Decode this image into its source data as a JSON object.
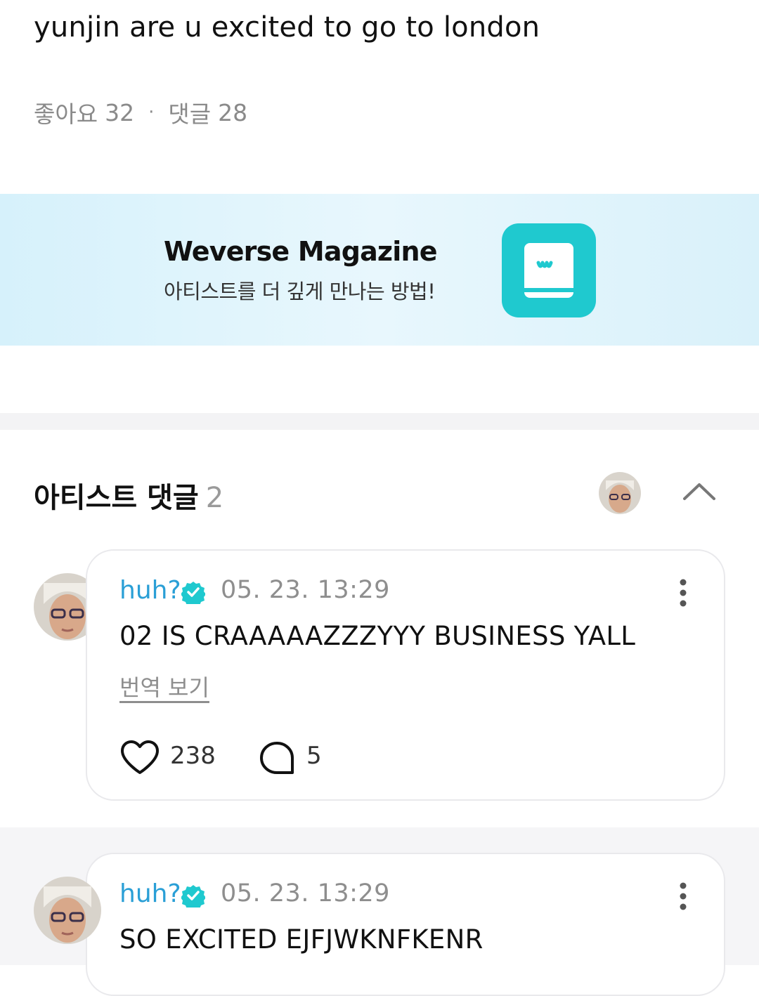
{
  "post": {
    "text": "yunjin are u excited to go to london",
    "likes_label": "좋아요",
    "likes": "32",
    "separator": "·",
    "comments_label": "댓글",
    "comments": "28"
  },
  "banner": {
    "title": "Weverse Magazine",
    "subtitle": "아티스트를 더 깊게 만나는 방법!",
    "logo_letter": "w",
    "colors": {
      "background": "#dff3fb",
      "app": "#1fc9cf"
    }
  },
  "artist_comments": {
    "title": "아티스트 댓글",
    "count": "2",
    "comments": [
      {
        "author": "huh?",
        "timestamp": "05. 23. 13:29",
        "text": "02 IS CRAAAAAZZZYYY BUSINESS YALL",
        "translate_label": "번역 보기",
        "likes": "238",
        "replies": "5"
      },
      {
        "author": "huh?",
        "timestamp": "05. 23. 13:29",
        "text": "SO EXCITED EJFJWKNFKENR"
      }
    ]
  },
  "colors": {
    "author": "#2a9fd6",
    "verified": "#1fc9cf"
  }
}
